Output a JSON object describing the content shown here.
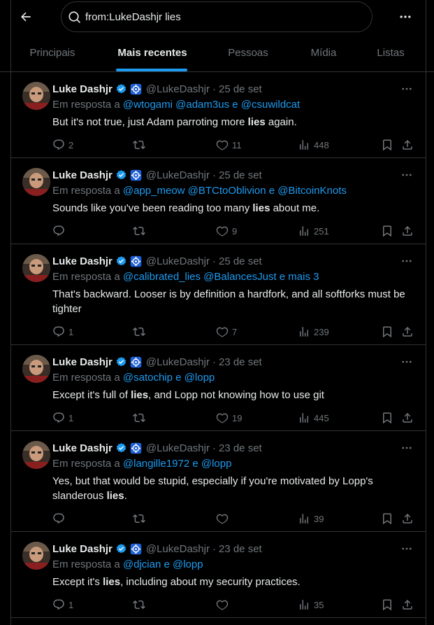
{
  "search": {
    "value": "from:LukeDashjr lies"
  },
  "tabs": [
    {
      "label": "Principais"
    },
    {
      "label": "Mais recentes"
    },
    {
      "label": "Pessoas"
    },
    {
      "label": "Mídia"
    },
    {
      "label": "Listas"
    }
  ],
  "colors": {
    "accent": "#1d9bf0",
    "muted": "#71767b",
    "text": "#e7e9ea",
    "border": "#2f3336"
  },
  "tweets": [
    {
      "name": "Luke Dashjr",
      "handle": "@LukeDashjr",
      "sep": "·",
      "date": "25 de set",
      "reply_prefix": "Em resposta a",
      "mentions": "@wtogami @adam3us e @csuwildcat",
      "text_before": "But it's not true, just Adam parroting more ",
      "text_bold": "lies",
      "text_after": " again.",
      "replies": "2",
      "retweets": "",
      "likes": "11",
      "views": "448"
    },
    {
      "name": "Luke Dashjr",
      "handle": "@LukeDashjr",
      "sep": "·",
      "date": "25 de set",
      "reply_prefix": "Em resposta a",
      "mentions": "@app_meow @BTCtoOblivion e @BitcoinKnots",
      "text_before": "Sounds like you've been reading too many ",
      "text_bold": "lies",
      "text_after": " about me.",
      "replies": "",
      "retweets": "",
      "likes": "9",
      "views": "251"
    },
    {
      "name": "Luke Dashjr",
      "handle": "@LukeDashjr",
      "sep": "·",
      "date": "25 de set",
      "reply_prefix": "Em resposta a",
      "mentions": "@calibrated_lies @BalancesJust e mais 3",
      "text_before": "That's backward. Looser is by definition a hardfork, and all softforks must be tighter",
      "text_bold": "",
      "text_after": "",
      "replies": "1",
      "retweets": "",
      "likes": "7",
      "views": "239"
    },
    {
      "name": "Luke Dashjr",
      "handle": "@LukeDashjr",
      "sep": "·",
      "date": "23 de set",
      "reply_prefix": "Em resposta a",
      "mentions": "@satochip e @lopp",
      "text_before": "Except it's full of ",
      "text_bold": "lies",
      "text_after": ", and Lopp not knowing how to use git",
      "replies": "1",
      "retweets": "",
      "likes": "19",
      "views": "445"
    },
    {
      "name": "Luke Dashjr",
      "handle": "@LukeDashjr",
      "sep": "·",
      "date": "23 de set",
      "reply_prefix": "Em resposta a",
      "mentions": "@langille1972 e @lopp",
      "text_before": "Yes, but that would be stupid, especially if you're motivated by Lopp's slanderous ",
      "text_bold": "lies",
      "text_after": ".",
      "replies": "",
      "retweets": "",
      "likes": "",
      "views": "39"
    },
    {
      "name": "Luke Dashjr",
      "handle": "@LukeDashjr",
      "sep": "·",
      "date": "23 de set",
      "reply_prefix": "Em resposta a",
      "mentions": "@djcian e @lopp",
      "text_before": "Except it's ",
      "text_bold": "lies",
      "text_after": ", including about my security practices.",
      "replies": "1",
      "retweets": "",
      "likes": "",
      "views": "35"
    }
  ]
}
